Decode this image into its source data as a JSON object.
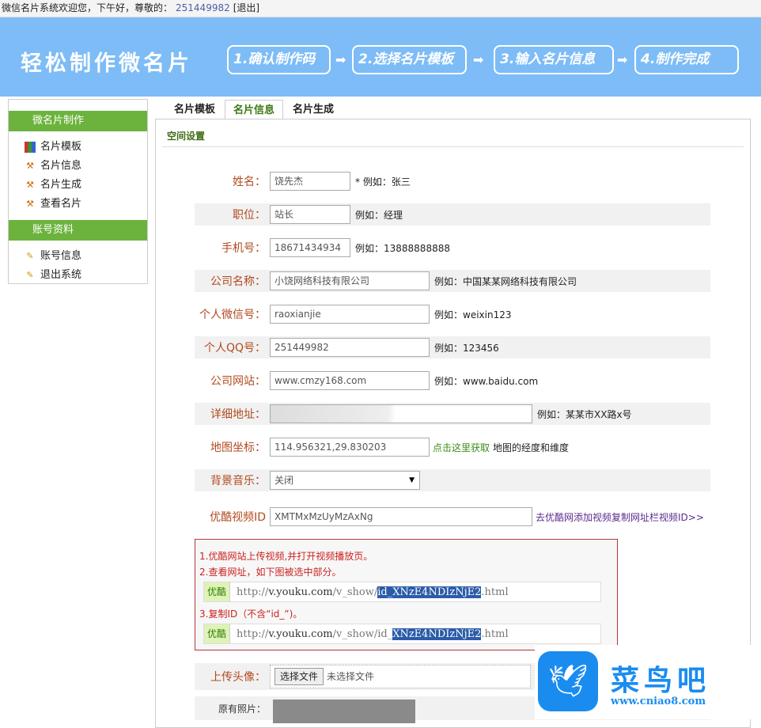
{
  "topbar": {
    "greeting": "微信名片系统欢迎您，下午好，尊敬的：",
    "user_id": "251449982",
    "logout": "[退出]"
  },
  "banner": {
    "title": "轻松制作微名片",
    "steps": [
      "1.确认制作码",
      "2.选择名片模板",
      "3.输入名片信息",
      "4.制作完成"
    ],
    "arrow": "➡"
  },
  "sidebar": {
    "sections": [
      {
        "title": "微名片制作",
        "items": [
          "名片模板",
          "名片信息",
          "名片生成",
          "查看名片"
        ]
      },
      {
        "title": "账号资料",
        "items": [
          "账号信息",
          "退出系统"
        ]
      }
    ]
  },
  "tabs": [
    "名片模板",
    "名片信息",
    "名片生成"
  ],
  "section_title": "空间设置",
  "form": {
    "name": {
      "label": "姓名：",
      "value": "饶先杰",
      "hint": "* 例如：张三"
    },
    "position": {
      "label": "职位：",
      "value": "站长",
      "hint": "例如：经理"
    },
    "phone": {
      "label": "手机号：",
      "value": "18671434934",
      "hint": "例如：13888888888"
    },
    "company": {
      "label": "公司名称：",
      "value": "小饶网络科技有限公司",
      "hint": "例如：中国某某网络科技有限公司"
    },
    "wechat": {
      "label": "个人微信号：",
      "value": "raoxianjie",
      "hint": "例如：weixin123"
    },
    "qq": {
      "label": "个人QQ号：",
      "value": "251449982",
      "hint": "例如：123456"
    },
    "website": {
      "label": "公司网站：",
      "value": "www.cmzy168.com",
      "hint": "例如：www.baidu.com"
    },
    "address": {
      "label": "详细地址：",
      "value": "",
      "hint": "例如：某某市XX路x号"
    },
    "map": {
      "label": "地图坐标：",
      "value": "114.956321,29.830203",
      "link": "点击这里获取",
      "hint": "地图的经度和维度"
    },
    "music": {
      "label": "背景音乐：",
      "value": "关闭"
    },
    "youku": {
      "label": "优酷视频ID",
      "value": "XMTMxMzUyMzAxNg",
      "link": "去优酷网添加视频复制网址栏视频ID>>"
    },
    "avatar": {
      "label": "上传头像：",
      "button": "选择文件",
      "status": "未选择文件"
    },
    "photo": {
      "label": "原有照片："
    }
  },
  "help": {
    "step1": "1.优酷网站上传视频,并打开视频播放页。",
    "step2": "2.查看网址，如下图被选中部分。",
    "step3": "3.复制ID（不含“id_”)。",
    "youku_tag": "优酷",
    "url1": {
      "pre": "http://",
      "host": "v.youku.com",
      "mid": "/v_show/",
      "sel": "id_XNzE4NDIzNjE2",
      "post": ".html"
    },
    "url2": {
      "pre": "http://",
      "host": "v.youku.com",
      "mid": "/v_show/id_",
      "sel": "XNzE4NDIzNjE2",
      "post": ".html"
    }
  },
  "watermark": {
    "name": "菜鸟吧",
    "url": "www.cniao8.com"
  }
}
